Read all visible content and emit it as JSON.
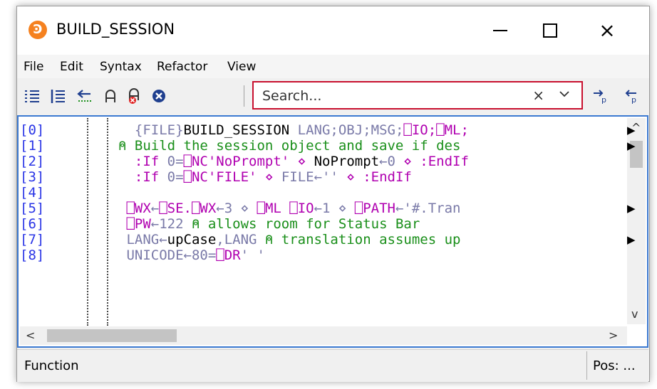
{
  "window": {
    "title": "BUILD_SESSION",
    "app_icon_glyph": "Ͽ"
  },
  "window_controls": {
    "minimize": "minimize",
    "maximize": "maximize",
    "close": "×"
  },
  "menu": [
    "File",
    "Edit",
    "Syntax",
    "Refactor",
    "View"
  ],
  "toolbar": {
    "icons": [
      "indent-lines-icon",
      "outdent-lines-icon",
      "toggle-comment-icon",
      "comment-icon",
      "uncomment-icon",
      "close-circle-icon"
    ],
    "search_placeholder": "Search...",
    "search_clear": "×",
    "search_dropdown": "chevron-down-icon",
    "extra_icons": [
      "find-next-icon",
      "find-prev-icon"
    ]
  },
  "editor": {
    "line_numbers": [
      "[0]",
      "[1]",
      "[2]",
      "[3]",
      "[4]",
      "[5]",
      "[6]",
      "[7]",
      "[8]"
    ],
    "lines": [
      [
        {
          "t": "  {FILE}",
          "c": "#7a7aa8"
        },
        {
          "t": "BUILD_SESSION",
          "c": "#000000"
        },
        {
          "t": " LANG;OBJ;MSG;",
          "c": "#7a7aa8"
        },
        {
          "t": "⎕IO;⎕ML;",
          "c": "#b000b0"
        }
      ],
      [
        {
          "t": "⍝ Build the session object and save if des",
          "c": "#1a8f1a"
        }
      ],
      [
        {
          "t": "  :If ",
          "c": "#b000b0"
        },
        {
          "t": "0=",
          "c": "#7a7aa8"
        },
        {
          "t": "⎕NC",
          "c": "#b000b0"
        },
        {
          "t": "'NoPrompt'",
          "c": "#b000b0"
        },
        {
          "t": " ⋄ ",
          "c": "#b000b0"
        },
        {
          "t": "NoPrompt",
          "c": "#000000"
        },
        {
          "t": "←0",
          "c": "#7a7aa8"
        },
        {
          "t": " ⋄ :EndIf",
          "c": "#b000b0"
        }
      ],
      [
        {
          "t": "  :If ",
          "c": "#b000b0"
        },
        {
          "t": "0=",
          "c": "#7a7aa8"
        },
        {
          "t": "⎕NC",
          "c": "#b000b0"
        },
        {
          "t": "'FILE'",
          "c": "#b000b0"
        },
        {
          "t": " ⋄ ",
          "c": "#b000b0"
        },
        {
          "t": "FILE←''",
          "c": "#7a7aa8"
        },
        {
          "t": " ⋄ :EndIf",
          "c": "#b000b0"
        }
      ],
      [
        {
          "t": "",
          "c": "#7a7aa8"
        }
      ],
      [
        {
          "t": " ⎕WX",
          "c": "#b000b0"
        },
        {
          "t": "←",
          "c": "#7a7aa8"
        },
        {
          "t": "⎕SE.⎕WX",
          "c": "#b000b0"
        },
        {
          "t": "←3 ⋄ ",
          "c": "#7a7aa8"
        },
        {
          "t": "⎕ML ⎕IO",
          "c": "#b000b0"
        },
        {
          "t": "←1 ⋄ ",
          "c": "#7a7aa8"
        },
        {
          "t": "⎕PATH",
          "c": "#b000b0"
        },
        {
          "t": "←'#.Tran",
          "c": "#7a7aa8"
        }
      ],
      [
        {
          "t": " ⎕PW",
          "c": "#b000b0"
        },
        {
          "t": "←122 ",
          "c": "#7a7aa8"
        },
        {
          "t": "⍝ allows room for Status Bar",
          "c": "#1a8f1a"
        }
      ],
      [
        {
          "t": " LANG←",
          "c": "#7a7aa8"
        },
        {
          "t": "upCase",
          "c": "#000000"
        },
        {
          "t": ",LANG ",
          "c": "#7a7aa8"
        },
        {
          "t": "⍝ translation assumes up",
          "c": "#1a8f1a"
        }
      ],
      [
        {
          "t": " UNICODE←80=",
          "c": "#7a7aa8"
        },
        {
          "t": "⎕DR",
          "c": "#b000b0"
        },
        {
          "t": "' '",
          "c": "#7a7aa8"
        }
      ]
    ],
    "overflow_rows": [
      0,
      1,
      5,
      7
    ]
  },
  "status": {
    "left": "Function",
    "right": "Pos: ..."
  }
}
